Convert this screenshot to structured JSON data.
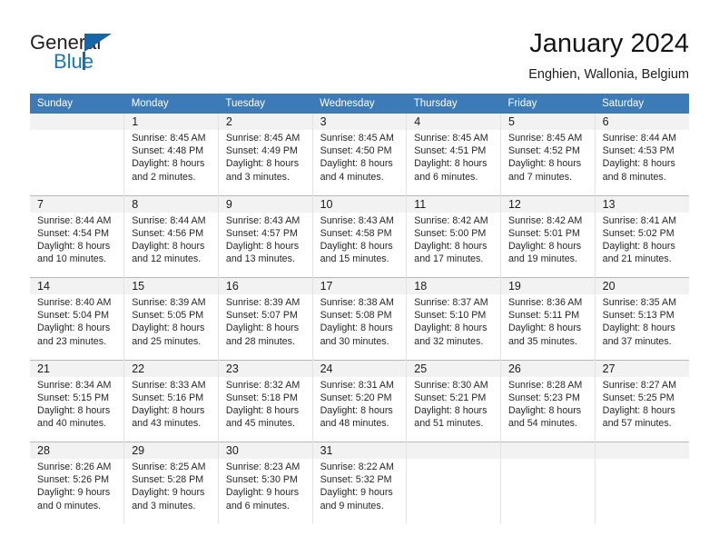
{
  "brand": {
    "name_part1": "General",
    "name_part2": "Blue",
    "triangle_icon": "triangle-icon",
    "accent_color": "#1565a8",
    "text_color": "#231f20"
  },
  "header": {
    "title": "January 2024",
    "subtitle": "Enghien, Wallonia, Belgium"
  },
  "calendar": {
    "header_bg": "#3c7ab8",
    "header_text_color": "#ffffff",
    "date_row_bg": "#f2f2f2",
    "weekday_headers": [
      "Sunday",
      "Monday",
      "Tuesday",
      "Wednesday",
      "Thursday",
      "Friday",
      "Saturday"
    ],
    "weeks": [
      {
        "days": [
          {
            "date": "",
            "sunrise": "",
            "sunset": "",
            "daylight_line1": "",
            "daylight_line2": ""
          },
          {
            "date": "1",
            "sunrise": "Sunrise: 8:45 AM",
            "sunset": "Sunset: 4:48 PM",
            "daylight_line1": "Daylight: 8 hours",
            "daylight_line2": "and 2 minutes."
          },
          {
            "date": "2",
            "sunrise": "Sunrise: 8:45 AM",
            "sunset": "Sunset: 4:49 PM",
            "daylight_line1": "Daylight: 8 hours",
            "daylight_line2": "and 3 minutes."
          },
          {
            "date": "3",
            "sunrise": "Sunrise: 8:45 AM",
            "sunset": "Sunset: 4:50 PM",
            "daylight_line1": "Daylight: 8 hours",
            "daylight_line2": "and 4 minutes."
          },
          {
            "date": "4",
            "sunrise": "Sunrise: 8:45 AM",
            "sunset": "Sunset: 4:51 PM",
            "daylight_line1": "Daylight: 8 hours",
            "daylight_line2": "and 6 minutes."
          },
          {
            "date": "5",
            "sunrise": "Sunrise: 8:45 AM",
            "sunset": "Sunset: 4:52 PM",
            "daylight_line1": "Daylight: 8 hours",
            "daylight_line2": "and 7 minutes."
          },
          {
            "date": "6",
            "sunrise": "Sunrise: 8:44 AM",
            "sunset": "Sunset: 4:53 PM",
            "daylight_line1": "Daylight: 8 hours",
            "daylight_line2": "and 8 minutes."
          }
        ]
      },
      {
        "days": [
          {
            "date": "7",
            "sunrise": "Sunrise: 8:44 AM",
            "sunset": "Sunset: 4:54 PM",
            "daylight_line1": "Daylight: 8 hours",
            "daylight_line2": "and 10 minutes."
          },
          {
            "date": "8",
            "sunrise": "Sunrise: 8:44 AM",
            "sunset": "Sunset: 4:56 PM",
            "daylight_line1": "Daylight: 8 hours",
            "daylight_line2": "and 12 minutes."
          },
          {
            "date": "9",
            "sunrise": "Sunrise: 8:43 AM",
            "sunset": "Sunset: 4:57 PM",
            "daylight_line1": "Daylight: 8 hours",
            "daylight_line2": "and 13 minutes."
          },
          {
            "date": "10",
            "sunrise": "Sunrise: 8:43 AM",
            "sunset": "Sunset: 4:58 PM",
            "daylight_line1": "Daylight: 8 hours",
            "daylight_line2": "and 15 minutes."
          },
          {
            "date": "11",
            "sunrise": "Sunrise: 8:42 AM",
            "sunset": "Sunset: 5:00 PM",
            "daylight_line1": "Daylight: 8 hours",
            "daylight_line2": "and 17 minutes."
          },
          {
            "date": "12",
            "sunrise": "Sunrise: 8:42 AM",
            "sunset": "Sunset: 5:01 PM",
            "daylight_line1": "Daylight: 8 hours",
            "daylight_line2": "and 19 minutes."
          },
          {
            "date": "13",
            "sunrise": "Sunrise: 8:41 AM",
            "sunset": "Sunset: 5:02 PM",
            "daylight_line1": "Daylight: 8 hours",
            "daylight_line2": "and 21 minutes."
          }
        ]
      },
      {
        "days": [
          {
            "date": "14",
            "sunrise": "Sunrise: 8:40 AM",
            "sunset": "Sunset: 5:04 PM",
            "daylight_line1": "Daylight: 8 hours",
            "daylight_line2": "and 23 minutes."
          },
          {
            "date": "15",
            "sunrise": "Sunrise: 8:39 AM",
            "sunset": "Sunset: 5:05 PM",
            "daylight_line1": "Daylight: 8 hours",
            "daylight_line2": "and 25 minutes."
          },
          {
            "date": "16",
            "sunrise": "Sunrise: 8:39 AM",
            "sunset": "Sunset: 5:07 PM",
            "daylight_line1": "Daylight: 8 hours",
            "daylight_line2": "and 28 minutes."
          },
          {
            "date": "17",
            "sunrise": "Sunrise: 8:38 AM",
            "sunset": "Sunset: 5:08 PM",
            "daylight_line1": "Daylight: 8 hours",
            "daylight_line2": "and 30 minutes."
          },
          {
            "date": "18",
            "sunrise": "Sunrise: 8:37 AM",
            "sunset": "Sunset: 5:10 PM",
            "daylight_line1": "Daylight: 8 hours",
            "daylight_line2": "and 32 minutes."
          },
          {
            "date": "19",
            "sunrise": "Sunrise: 8:36 AM",
            "sunset": "Sunset: 5:11 PM",
            "daylight_line1": "Daylight: 8 hours",
            "daylight_line2": "and 35 minutes."
          },
          {
            "date": "20",
            "sunrise": "Sunrise: 8:35 AM",
            "sunset": "Sunset: 5:13 PM",
            "daylight_line1": "Daylight: 8 hours",
            "daylight_line2": "and 37 minutes."
          }
        ]
      },
      {
        "days": [
          {
            "date": "21",
            "sunrise": "Sunrise: 8:34 AM",
            "sunset": "Sunset: 5:15 PM",
            "daylight_line1": "Daylight: 8 hours",
            "daylight_line2": "and 40 minutes."
          },
          {
            "date": "22",
            "sunrise": "Sunrise: 8:33 AM",
            "sunset": "Sunset: 5:16 PM",
            "daylight_line1": "Daylight: 8 hours",
            "daylight_line2": "and 43 minutes."
          },
          {
            "date": "23",
            "sunrise": "Sunrise: 8:32 AM",
            "sunset": "Sunset: 5:18 PM",
            "daylight_line1": "Daylight: 8 hours",
            "daylight_line2": "and 45 minutes."
          },
          {
            "date": "24",
            "sunrise": "Sunrise: 8:31 AM",
            "sunset": "Sunset: 5:20 PM",
            "daylight_line1": "Daylight: 8 hours",
            "daylight_line2": "and 48 minutes."
          },
          {
            "date": "25",
            "sunrise": "Sunrise: 8:30 AM",
            "sunset": "Sunset: 5:21 PM",
            "daylight_line1": "Daylight: 8 hours",
            "daylight_line2": "and 51 minutes."
          },
          {
            "date": "26",
            "sunrise": "Sunrise: 8:28 AM",
            "sunset": "Sunset: 5:23 PM",
            "daylight_line1": "Daylight: 8 hours",
            "daylight_line2": "and 54 minutes."
          },
          {
            "date": "27",
            "sunrise": "Sunrise: 8:27 AM",
            "sunset": "Sunset: 5:25 PM",
            "daylight_line1": "Daylight: 8 hours",
            "daylight_line2": "and 57 minutes."
          }
        ]
      },
      {
        "days": [
          {
            "date": "28",
            "sunrise": "Sunrise: 8:26 AM",
            "sunset": "Sunset: 5:26 PM",
            "daylight_line1": "Daylight: 9 hours",
            "daylight_line2": "and 0 minutes."
          },
          {
            "date": "29",
            "sunrise": "Sunrise: 8:25 AM",
            "sunset": "Sunset: 5:28 PM",
            "daylight_line1": "Daylight: 9 hours",
            "daylight_line2": "and 3 minutes."
          },
          {
            "date": "30",
            "sunrise": "Sunrise: 8:23 AM",
            "sunset": "Sunset: 5:30 PM",
            "daylight_line1": "Daylight: 9 hours",
            "daylight_line2": "and 6 minutes."
          },
          {
            "date": "31",
            "sunrise": "Sunrise: 8:22 AM",
            "sunset": "Sunset: 5:32 PM",
            "daylight_line1": "Daylight: 9 hours",
            "daylight_line2": "and 9 minutes."
          },
          {
            "date": "",
            "sunrise": "",
            "sunset": "",
            "daylight_line1": "",
            "daylight_line2": ""
          },
          {
            "date": "",
            "sunrise": "",
            "sunset": "",
            "daylight_line1": "",
            "daylight_line2": ""
          },
          {
            "date": "",
            "sunrise": "",
            "sunset": "",
            "daylight_line1": "",
            "daylight_line2": ""
          }
        ]
      }
    ]
  }
}
